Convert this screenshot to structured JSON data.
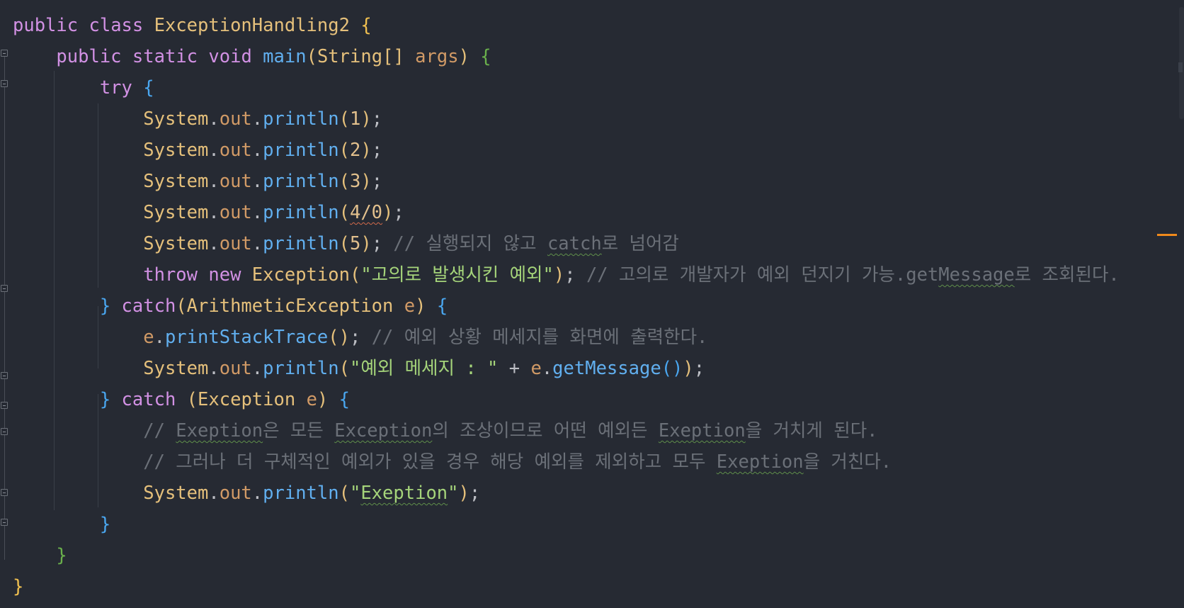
{
  "editor": {
    "language": "java",
    "lines": [
      {
        "tokens": [
          {
            "t": "public",
            "c": "kw"
          },
          {
            "t": " ",
            "c": "punc"
          },
          {
            "t": "class",
            "c": "kw"
          },
          {
            "t": " ",
            "c": "punc"
          },
          {
            "t": "ExceptionHandling2",
            "c": "cls"
          },
          {
            "t": " ",
            "c": "punc"
          },
          {
            "t": "{",
            "c": "brace-y"
          }
        ]
      },
      {
        "tokens": [
          {
            "t": "    ",
            "c": "punc"
          },
          {
            "t": "public",
            "c": "kw"
          },
          {
            "t": " ",
            "c": "punc"
          },
          {
            "t": "static",
            "c": "kw"
          },
          {
            "t": " ",
            "c": "punc"
          },
          {
            "t": "void",
            "c": "kw"
          },
          {
            "t": " ",
            "c": "punc"
          },
          {
            "t": "main",
            "c": "fn"
          },
          {
            "t": "(",
            "c": "paren-y"
          },
          {
            "t": "String[]",
            "c": "cls"
          },
          {
            "t": " ",
            "c": "punc"
          },
          {
            "t": "args",
            "c": "param"
          },
          {
            "t": ")",
            "c": "paren-y"
          },
          {
            "t": " ",
            "c": "punc"
          },
          {
            "t": "{",
            "c": "brace-g"
          }
        ]
      },
      {
        "tokens": [
          {
            "t": "        ",
            "c": "punc"
          },
          {
            "t": "try",
            "c": "kw"
          },
          {
            "t": " ",
            "c": "punc"
          },
          {
            "t": "{",
            "c": "brace-b"
          }
        ]
      },
      {
        "tokens": [
          {
            "t": "            ",
            "c": "punc"
          },
          {
            "t": "System",
            "c": "cls"
          },
          {
            "t": ".",
            "c": "punc"
          },
          {
            "t": "out",
            "c": "field"
          },
          {
            "t": ".",
            "c": "punc"
          },
          {
            "t": "println",
            "c": "fn"
          },
          {
            "t": "(",
            "c": "paren-y"
          },
          {
            "t": "1",
            "c": "num"
          },
          {
            "t": ")",
            "c": "paren-y"
          },
          {
            "t": ";",
            "c": "punc"
          }
        ]
      },
      {
        "tokens": [
          {
            "t": "            ",
            "c": "punc"
          },
          {
            "t": "System",
            "c": "cls"
          },
          {
            "t": ".",
            "c": "punc"
          },
          {
            "t": "out",
            "c": "field"
          },
          {
            "t": ".",
            "c": "punc"
          },
          {
            "t": "println",
            "c": "fn"
          },
          {
            "t": "(",
            "c": "paren-y"
          },
          {
            "t": "2",
            "c": "num"
          },
          {
            "t": ")",
            "c": "paren-y"
          },
          {
            "t": ";",
            "c": "punc"
          }
        ]
      },
      {
        "tokens": [
          {
            "t": "            ",
            "c": "punc"
          },
          {
            "t": "System",
            "c": "cls"
          },
          {
            "t": ".",
            "c": "punc"
          },
          {
            "t": "out",
            "c": "field"
          },
          {
            "t": ".",
            "c": "punc"
          },
          {
            "t": "println",
            "c": "fn"
          },
          {
            "t": "(",
            "c": "paren-y"
          },
          {
            "t": "3",
            "c": "num"
          },
          {
            "t": ")",
            "c": "paren-y"
          },
          {
            "t": ";",
            "c": "punc"
          }
        ]
      },
      {
        "tokens": [
          {
            "t": "            ",
            "c": "punc"
          },
          {
            "t": "System",
            "c": "cls"
          },
          {
            "t": ".",
            "c": "punc"
          },
          {
            "t": "out",
            "c": "field"
          },
          {
            "t": ".",
            "c": "punc"
          },
          {
            "t": "println",
            "c": "fn"
          },
          {
            "t": "(",
            "c": "paren-y"
          },
          {
            "t": "4/0",
            "c": "num err"
          },
          {
            "t": ")",
            "c": "paren-y"
          },
          {
            "t": ";",
            "c": "punc"
          }
        ]
      },
      {
        "tokens": [
          {
            "t": "            ",
            "c": "punc"
          },
          {
            "t": "System",
            "c": "cls"
          },
          {
            "t": ".",
            "c": "punc"
          },
          {
            "t": "out",
            "c": "field"
          },
          {
            "t": ".",
            "c": "punc"
          },
          {
            "t": "println",
            "c": "fn"
          },
          {
            "t": "(",
            "c": "paren-y"
          },
          {
            "t": "5",
            "c": "num"
          },
          {
            "t": ")",
            "c": "paren-y"
          },
          {
            "t": ";",
            "c": "punc"
          },
          {
            "t": " ",
            "c": "punc"
          },
          {
            "t": "// 실행되지 않고 ",
            "c": "cmt"
          },
          {
            "t": "catch",
            "c": "cmt typo"
          },
          {
            "t": "로 넘어감",
            "c": "cmt"
          }
        ]
      },
      {
        "tokens": [
          {
            "t": "            ",
            "c": "punc"
          },
          {
            "t": "throw",
            "c": "kw"
          },
          {
            "t": " ",
            "c": "punc"
          },
          {
            "t": "new",
            "c": "kw"
          },
          {
            "t": " ",
            "c": "punc"
          },
          {
            "t": "Exception",
            "c": "cls"
          },
          {
            "t": "(",
            "c": "paren-y"
          },
          {
            "t": "\"고의로 발생시킨 예외\"",
            "c": "str"
          },
          {
            "t": ")",
            "c": "paren-y"
          },
          {
            "t": ";",
            "c": "punc"
          },
          {
            "t": " ",
            "c": "punc"
          },
          {
            "t": "// 고의로 개발자가 예외 던지기 가능.get",
            "c": "cmt"
          },
          {
            "t": "Message",
            "c": "cmt typo"
          },
          {
            "t": "로 조회된다.",
            "c": "cmt"
          }
        ]
      },
      {
        "tokens": [
          {
            "t": "        ",
            "c": "punc"
          },
          {
            "t": "}",
            "c": "brace-b"
          },
          {
            "t": " ",
            "c": "punc"
          },
          {
            "t": "catch",
            "c": "kw"
          },
          {
            "t": "(",
            "c": "paren-y"
          },
          {
            "t": "ArithmeticException",
            "c": "cls"
          },
          {
            "t": " ",
            "c": "punc"
          },
          {
            "t": "e",
            "c": "param"
          },
          {
            "t": ")",
            "c": "paren-y"
          },
          {
            "t": " ",
            "c": "punc"
          },
          {
            "t": "{",
            "c": "brace-b"
          }
        ]
      },
      {
        "tokens": [
          {
            "t": "            ",
            "c": "punc"
          },
          {
            "t": "e",
            "c": "param"
          },
          {
            "t": ".",
            "c": "punc"
          },
          {
            "t": "printStackTrace",
            "c": "fn"
          },
          {
            "t": "()",
            "c": "paren-y"
          },
          {
            "t": ";",
            "c": "punc"
          },
          {
            "t": " ",
            "c": "punc"
          },
          {
            "t": "// 예외 상황 메세지를 화면에 출력한다.",
            "c": "cmt"
          }
        ]
      },
      {
        "tokens": [
          {
            "t": "            ",
            "c": "punc"
          },
          {
            "t": "System",
            "c": "cls"
          },
          {
            "t": ".",
            "c": "punc"
          },
          {
            "t": "out",
            "c": "field"
          },
          {
            "t": ".",
            "c": "punc"
          },
          {
            "t": "println",
            "c": "fn"
          },
          {
            "t": "(",
            "c": "paren-y"
          },
          {
            "t": "\"예외 메세지 : \"",
            "c": "str"
          },
          {
            "t": " + ",
            "c": "punc"
          },
          {
            "t": "e",
            "c": "param"
          },
          {
            "t": ".",
            "c": "punc"
          },
          {
            "t": "getMessage",
            "c": "fn"
          },
          {
            "t": "()",
            "c": "paren-b"
          },
          {
            "t": ")",
            "c": "paren-y"
          },
          {
            "t": ";",
            "c": "punc"
          }
        ]
      },
      {
        "tokens": [
          {
            "t": "        ",
            "c": "punc"
          },
          {
            "t": "}",
            "c": "brace-b"
          },
          {
            "t": " ",
            "c": "punc"
          },
          {
            "t": "catch",
            "c": "kw"
          },
          {
            "t": " ",
            "c": "punc"
          },
          {
            "t": "(",
            "c": "paren-y"
          },
          {
            "t": "Exception",
            "c": "cls"
          },
          {
            "t": " ",
            "c": "punc"
          },
          {
            "t": "e",
            "c": "param"
          },
          {
            "t": ")",
            "c": "paren-y"
          },
          {
            "t": " ",
            "c": "punc"
          },
          {
            "t": "{",
            "c": "brace-b"
          }
        ]
      },
      {
        "tokens": [
          {
            "t": "            ",
            "c": "punc"
          },
          {
            "t": "// ",
            "c": "cmt"
          },
          {
            "t": "Exeption",
            "c": "cmt typo"
          },
          {
            "t": "은 모든 ",
            "c": "cmt"
          },
          {
            "t": "Exception",
            "c": "cmt typo"
          },
          {
            "t": "의 조상이므로 어떤 예외든 ",
            "c": "cmt"
          },
          {
            "t": "Exeption",
            "c": "cmt typo"
          },
          {
            "t": "을 거치게 된다.",
            "c": "cmt"
          }
        ]
      },
      {
        "tokens": [
          {
            "t": "            ",
            "c": "punc"
          },
          {
            "t": "// 그러나 더 구체적인 예외가 있을 경우 해당 예외를 제외하고 모두 ",
            "c": "cmt"
          },
          {
            "t": "Exeption",
            "c": "cmt typo"
          },
          {
            "t": "을 거친다.",
            "c": "cmt"
          }
        ]
      },
      {
        "tokens": [
          {
            "t": "            ",
            "c": "punc"
          },
          {
            "t": "System",
            "c": "cls"
          },
          {
            "t": ".",
            "c": "punc"
          },
          {
            "t": "out",
            "c": "field"
          },
          {
            "t": ".",
            "c": "punc"
          },
          {
            "t": "println",
            "c": "fn"
          },
          {
            "t": "(",
            "c": "paren-y"
          },
          {
            "t": "\"",
            "c": "str"
          },
          {
            "t": "Exeption",
            "c": "str typo"
          },
          {
            "t": "\"",
            "c": "str"
          },
          {
            "t": ")",
            "c": "paren-y"
          },
          {
            "t": ";",
            "c": "punc"
          }
        ]
      },
      {
        "tokens": [
          {
            "t": "        ",
            "c": "punc"
          },
          {
            "t": "}",
            "c": "brace-b"
          }
        ]
      },
      {
        "tokens": [
          {
            "t": "    ",
            "c": "punc"
          },
          {
            "t": "}",
            "c": "brace-g"
          }
        ]
      },
      {
        "tokens": [
          {
            "t": "}",
            "c": "brace-y"
          }
        ]
      }
    ]
  },
  "colors": {
    "background": "#262a33",
    "keyword": "#d291e4",
    "class": "#e5c07b",
    "function": "#61afef",
    "field": "#d19a66",
    "string": "#a5d47a",
    "comment": "#6b7078",
    "warning": "#f08a1c"
  }
}
